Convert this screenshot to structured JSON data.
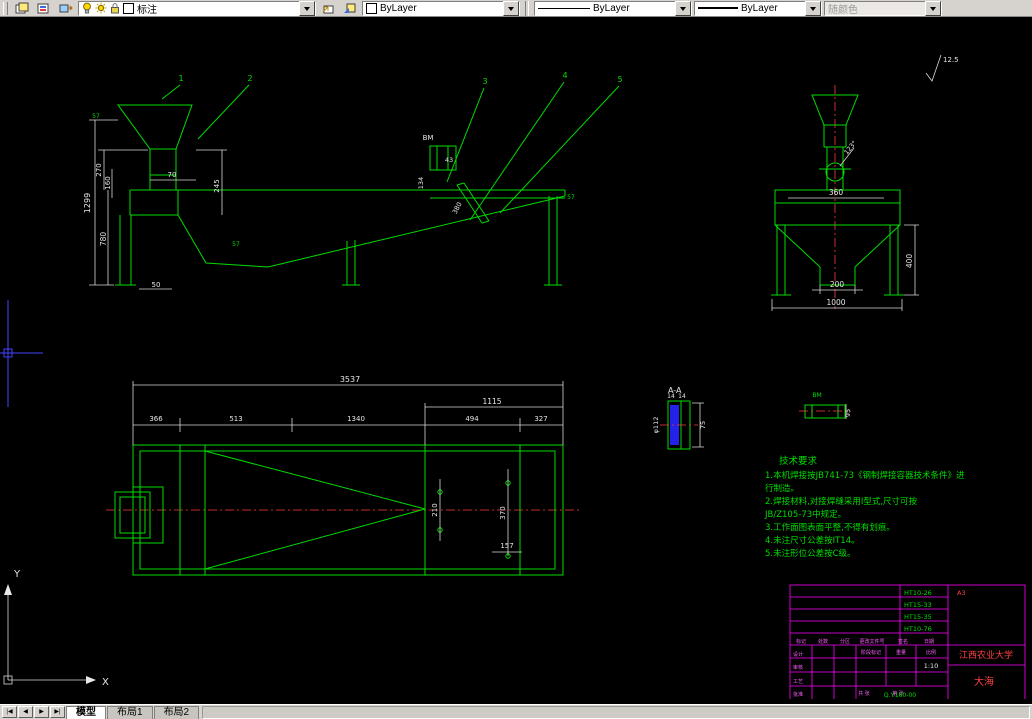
{
  "toolbar": {
    "layer": {
      "value": "标注"
    },
    "color": {
      "value": "ByLayer"
    },
    "linetype": {
      "value": "ByLayer"
    },
    "lineweight": {
      "value": "ByLayer"
    },
    "plot_style": {
      "value": "随颜色"
    }
  },
  "tabbar": {
    "nav": {
      "first": "|◀",
      "prev": "◀",
      "next": "▶",
      "last": "▶|"
    },
    "tabs": [
      {
        "label": "模型",
        "active": true
      },
      {
        "label": "布局1",
        "active": false
      },
      {
        "label": "布局2",
        "active": false
      }
    ]
  },
  "ucs": {
    "x": "X",
    "y": "Y"
  },
  "drawing": {
    "part_labels": {
      "n1": "1",
      "n2": "2",
      "n3": "3",
      "n4": "4",
      "n5": "5"
    },
    "weld": {
      "a": "57",
      "b": "57",
      "c": "57"
    },
    "roughness": "12.5",
    "side": {
      "d1299": "1299",
      "d270": "270",
      "d160": "160",
      "d780": "780",
      "d245": "245",
      "d70": "70",
      "d50": "50",
      "d43": "43",
      "d134": "134",
      "d380": "380",
      "bm": "BM"
    },
    "front": {
      "d360": "360",
      "d200": "200",
      "d1000": "1000",
      "d400": "400",
      "d123": "123°"
    },
    "plan": {
      "d3537": "3537",
      "d1115": "1115",
      "d366": "366",
      "d513": "513",
      "d1340": "1340",
      "d494": "494",
      "d327": "327",
      "d210": "210",
      "d370": "370",
      "d157": "157"
    },
    "aa": {
      "title": "A-A",
      "dphi": "φ112",
      "d14a": "14",
      "d14b": "14",
      "d75": "75"
    },
    "detail": {
      "bm": "BM",
      "d95": "95"
    },
    "notes": {
      "title": "技术要求",
      "lines": [
        "1.本机焊接按JB741-73《钢制焊接容器技术条件》进",
        "行制造。",
        "2.焊接材料,对接焊缝采用I型式,尺寸可按",
        "JB/Z105-73中规定。",
        "3.工作面图表面平整,不得有划痕。",
        "4.未注尺寸公差按IT14。",
        "5.未注形位公差按C级。"
      ]
    },
    "title_block": {
      "codes": [
        "HT10-26",
        "HT15-33",
        "HT15-35",
        "HT10-76"
      ],
      "paper": "A3",
      "header_cols": [
        "标记",
        "处数",
        "分区",
        "更改文件号",
        "签名",
        "日期"
      ],
      "sign_labels": [
        "设计",
        "审核",
        "工艺",
        "批准"
      ],
      "stage": "阶段标记",
      "weight": "重量",
      "scale_label": "比例",
      "scale": "1:10",
      "total": "共 张",
      "page": "第 张",
      "university": "江西农业大学",
      "title": "大海",
      "doc_no": "Q.Y.160-00"
    }
  }
}
